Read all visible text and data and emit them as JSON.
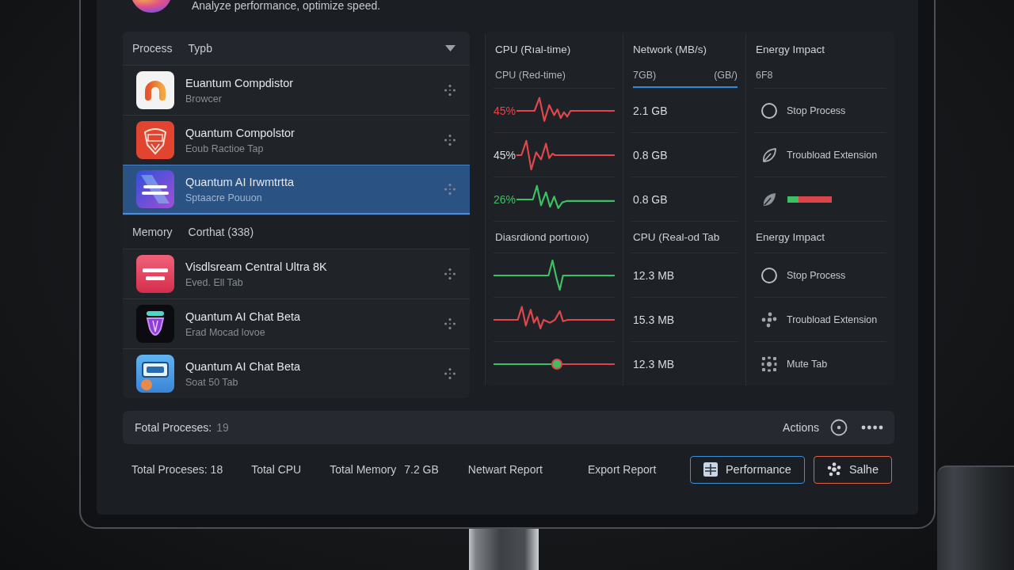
{
  "header": {
    "subtitle": "Analyze performance, optimize speed."
  },
  "process_panel": {
    "sections": [
      {
        "columns": [
          "Process",
          "Typb"
        ],
        "has_dropdown": true,
        "rows": [
          {
            "name": "Euantum Compdistor",
            "detail": "Browcer",
            "selected": false
          },
          {
            "name": "Quantum Compolstor",
            "detail": "Eoub Ractioe Tap",
            "selected": false
          },
          {
            "name": "Quantum AI Irwmtrtta",
            "detail": "Sptaacre Pouuon",
            "selected": true
          }
        ]
      },
      {
        "columns": [
          "Memory",
          "Corthat (338)"
        ],
        "has_dropdown": false,
        "rows": [
          {
            "name": "Visdlsream Central Ultra 8K",
            "detail": "Eved. Ell Tab",
            "selected": false
          },
          {
            "name": "Quantum AI Chat Beta",
            "detail": "Erad Mocad lovoe",
            "selected": false
          },
          {
            "name": "Quantum AI Chat Beta",
            "detail": "Soat 50 Tab",
            "selected": false
          }
        ]
      }
    ]
  },
  "metrics": {
    "columns": [
      {
        "title": "CPU (Rıal-time)",
        "subtitle": {
          "parts": [
            "CPU (Red-time)"
          ],
          "underlined": false
        },
        "rows": [
          {
            "kind": "trace",
            "reading": "45%",
            "color": "#e0474c",
            "tinted": true
          },
          {
            "kind": "trace",
            "reading": "45%",
            "color": "#e0474c",
            "tinted": false
          },
          {
            "kind": "trace",
            "reading": "26%",
            "color": "#3fbf63",
            "tinted": true
          }
        ],
        "section_title": "Diasrdiond portıoıo)",
        "section_rows": [
          {
            "kind": "trace",
            "color": "#3fbf63"
          },
          {
            "kind": "trace",
            "color": "#e0474c"
          },
          {
            "kind": "slider",
            "level": 0.52
          }
        ]
      },
      {
        "title": "Network (MB/s)",
        "subtitle": {
          "parts": [
            "7GB)",
            "(GB/)"
          ],
          "underlined": true
        },
        "rows": [
          {
            "kind": "value",
            "value": "2.1 GB"
          },
          {
            "kind": "value",
            "value": "0.8 GB"
          },
          {
            "kind": "value",
            "value": "0.8 GB"
          }
        ],
        "section_title": "CPU (Real-od Tab",
        "section_rows": [
          {
            "kind": "value",
            "value": "12.3 MB"
          },
          {
            "kind": "value",
            "value": "15.3 MB"
          },
          {
            "kind": "value",
            "value": "12.3 MB"
          }
        ]
      },
      {
        "title": "Energy Impact",
        "subtitle": {
          "parts": [
            "6F8"
          ],
          "underlined": false
        },
        "rows": [
          {
            "kind": "action",
            "label": "Stop Process"
          },
          {
            "kind": "action",
            "label": "Troubload Extension"
          },
          {
            "kind": "meter",
            "level": 0.25
          }
        ],
        "section_title": "Energy Impact",
        "section_rows": [
          {
            "kind": "action",
            "label": "Stop Process"
          },
          {
            "kind": "action",
            "label": "Troubload Extension"
          },
          {
            "kind": "action",
            "label": "Mute Tab"
          }
        ]
      }
    ]
  },
  "summary_bar": {
    "label": "Fotal Proceses:",
    "value": "19",
    "actions_label": "Actions"
  },
  "footer": {
    "stats": [
      {
        "label": "Total Proceses: 18"
      },
      {
        "label": "Total CPU"
      },
      {
        "label": "Total Memory",
        "value": "7.2 GB"
      }
    ],
    "links": [
      "Netwart Report",
      "Export Report"
    ],
    "buttons": [
      {
        "label": "Performance",
        "color": "#3b8fd8"
      },
      {
        "label": "Salhe",
        "color": "#e0604a"
      }
    ]
  }
}
